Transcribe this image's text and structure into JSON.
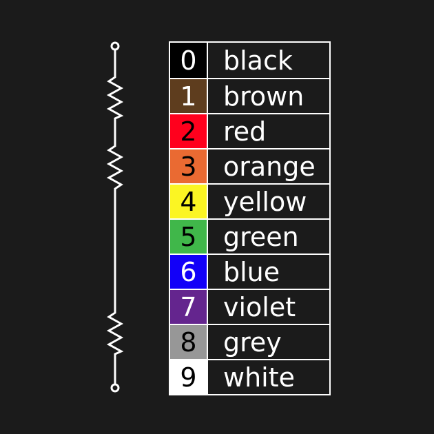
{
  "colors": [
    {
      "digit": "0",
      "name": "black",
      "swatch": "#000000",
      "digit_color": "#ffffff"
    },
    {
      "digit": "1",
      "name": "brown",
      "swatch": "#5e3d1e",
      "digit_color": "#ffffff"
    },
    {
      "digit": "2",
      "name": "red",
      "swatch": "#ff001d",
      "digit_color": "#000000"
    },
    {
      "digit": "3",
      "name": "orange",
      "swatch": "#ea6a32",
      "digit_color": "#000000"
    },
    {
      "digit": "4",
      "name": "yellow",
      "swatch": "#fbf523",
      "digit_color": "#000000"
    },
    {
      "digit": "5",
      "name": "green",
      "swatch": "#40b74a",
      "digit_color": "#000000"
    },
    {
      "digit": "6",
      "name": "blue",
      "swatch": "#1200f8",
      "digit_color": "#ffffff"
    },
    {
      "digit": "7",
      "name": "violet",
      "swatch": "#64258e",
      "digit_color": "#ffffff"
    },
    {
      "digit": "8",
      "name": "grey",
      "swatch": "#979797",
      "digit_color": "#000000"
    },
    {
      "digit": "9",
      "name": "white",
      "swatch": "#ffffff",
      "digit_color": "#000000"
    }
  ],
  "background": "#1b1b1b",
  "resistor_icon": "resistor-series-icon"
}
